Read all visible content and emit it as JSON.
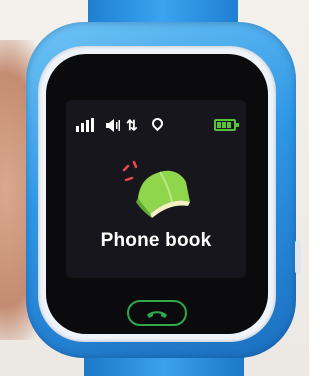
{
  "app": {
    "label": "Phone book",
    "icon": "phone-book-icon"
  },
  "status_bar": {
    "signal_icon": "signal-bars-icon",
    "volume_icon": "speaker-icon",
    "data_icon": "data-transfer-icon",
    "location_icon": "location-pin-icon",
    "battery_icon": "battery-icon",
    "battery_level": 1.0
  },
  "controls": {
    "call_icon": "phone-call-icon"
  },
  "colors": {
    "case": "#2f97e6",
    "battery": "#57c13a",
    "call_button": "#2ea84a",
    "book_green": "#8fd64c",
    "book_cream": "#f3f0c4",
    "hearts": "#e84a4a"
  }
}
